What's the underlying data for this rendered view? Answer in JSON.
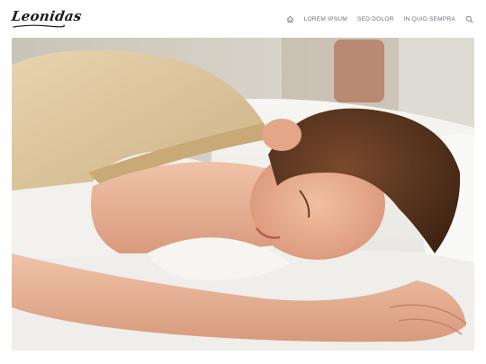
{
  "brand": {
    "logo_text": "Leonidas"
  },
  "nav": {
    "home_icon": "home-icon",
    "items": [
      {
        "label": "LOREM IPSUM"
      },
      {
        "label": "SED DOLOR"
      },
      {
        "label": "IN QUID SEMPRA"
      }
    ],
    "search_icon": "search-icon"
  },
  "colors": {
    "nav_text": "#6b6f78",
    "logo": "#1a1a1a",
    "background": "#ffffff"
  }
}
